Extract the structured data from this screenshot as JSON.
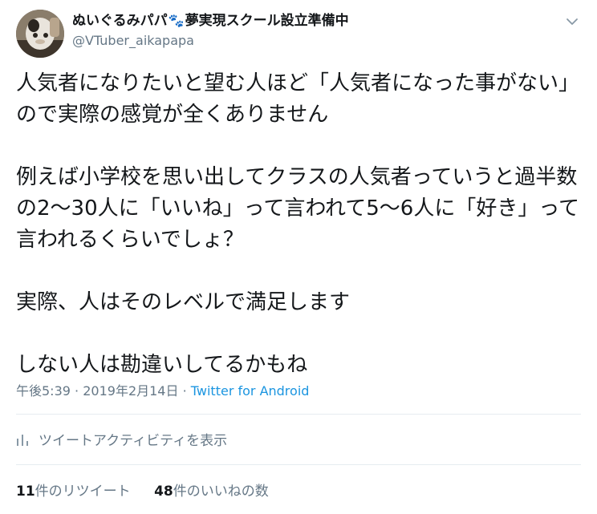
{
  "user": {
    "display_name": "ぬいぐるみパパ",
    "display_name_suffix": "夢実現スクール設立準備中",
    "handle": "@VTuber_aikapapa",
    "name_icon": "paw-prints-icon"
  },
  "tweet": {
    "text": "人気者になりたいと望む人ほど「人気者になった事がない」ので実際の感覚が全くありません\n\n例えば小学校を思い出してクラスの人気者っていうと過半数の2〜30人に「いいね」って言われて5〜6人に「好き」って言われるくらいでしょ？\n\n実際、人はそのレベルで満足します\n\nしない人は勘違いしてるかもね",
    "time": "午後5:39",
    "date": "2019年2月14日",
    "separator": "·",
    "source": "Twitter for Android"
  },
  "activity": {
    "label": "ツイートアクティビティを表示",
    "icon": "activity-bars-icon"
  },
  "stats": {
    "retweets_count": "11",
    "retweets_label": "件のリツイート",
    "likes_count": "48",
    "likes_label": "件のいいねの数"
  },
  "colors": {
    "text": "#14171a",
    "secondary": "#657786",
    "link": "#1b95e0",
    "divider": "#e6ecf0"
  }
}
